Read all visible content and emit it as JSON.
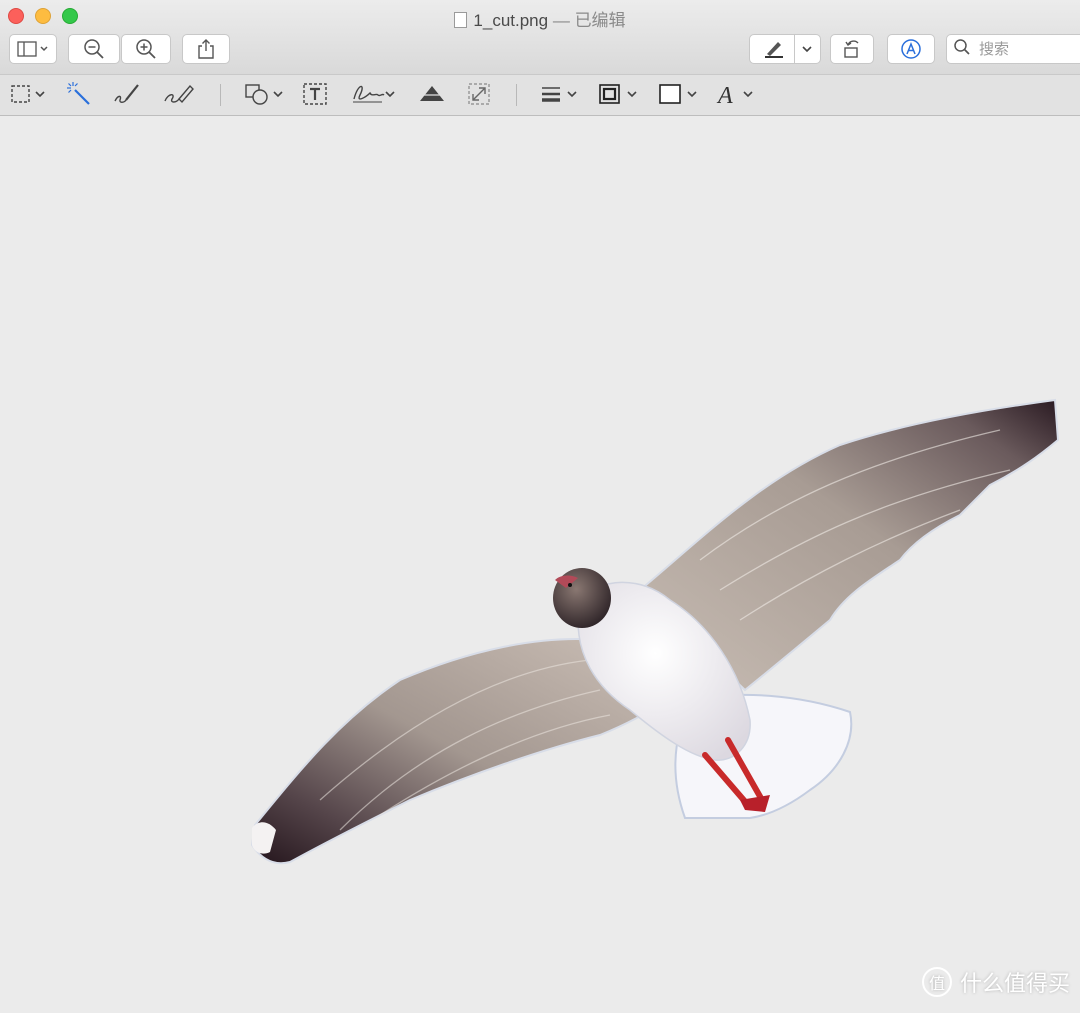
{
  "window": {
    "title": "1_cut.png",
    "title_separator": " — ",
    "edited_status": "已编辑"
  },
  "toolbar": {
    "search_placeholder": "搜索",
    "icons": [
      "sidebar-icon",
      "zoom-out-icon",
      "zoom-in-icon",
      "share-icon",
      "pen-icon",
      "rotate-icon",
      "markup-icon",
      "search-icon"
    ]
  },
  "markup_toolbar": {
    "icons": [
      "rect-select-icon",
      "instant-alpha-icon",
      "sketch-icon",
      "draw-icon",
      "shapes-icon",
      "text-icon",
      "sign-icon",
      "adjust-color-icon",
      "adjust-size-icon",
      "line-style-icon",
      "border-color-icon",
      "fill-color-icon",
      "text-style-icon"
    ]
  },
  "canvas": {
    "image": "seagull-cutout"
  },
  "watermark": {
    "logo_char": "值",
    "text": "什么值得买"
  },
  "colors": {
    "titlebar": "#e0e0e0",
    "canvas_bg": "#ebebeb",
    "close": "#fc605b",
    "minimize": "#fdbc40",
    "maximize": "#34c84a",
    "accent": "#2a6fdb"
  }
}
